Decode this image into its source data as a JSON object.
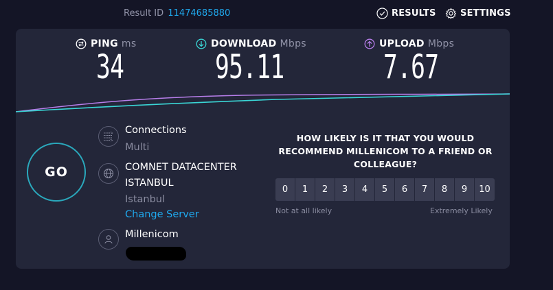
{
  "header": {
    "result_label": "Result ID",
    "result_id": "11474685880",
    "results_label": "RESULTS",
    "settings_label": "SETTINGS"
  },
  "metrics": {
    "ping": {
      "label": "PING",
      "unit": "ms",
      "value": "34",
      "icon": "ping-icon"
    },
    "download": {
      "label": "DOWNLOAD",
      "unit": "Mbps",
      "value": "95.11",
      "icon": "download-arrow-icon",
      "color": "#3ad6d6"
    },
    "upload": {
      "label": "UPLOAD",
      "unit": "Mbps",
      "value": "7.67",
      "icon": "upload-arrow-icon",
      "color": "#b77eea"
    }
  },
  "go_label": "GO",
  "connections": {
    "title": "Connections",
    "value": "Multi",
    "icon": "connections-icon"
  },
  "server": {
    "name_line1": "COMNET DATACENTER",
    "name_line2": "ISTANBUL",
    "location": "Istanbul",
    "change_label": "Change Server",
    "icon": "globe-icon"
  },
  "provider": {
    "name": "Millenicom",
    "icon": "user-icon"
  },
  "survey": {
    "question": "HOW LIKELY IS IT THAT YOU WOULD RECOMMEND MILLENICOM TO A FRIEND OR COLLEAGUE?",
    "scale": [
      "0",
      "1",
      "2",
      "3",
      "4",
      "5",
      "6",
      "7",
      "8",
      "9",
      "10"
    ],
    "low_label": "Not at all likely",
    "high_label": "Extremely Likely"
  },
  "colors": {
    "background": "#141526",
    "panel": "#232639",
    "accent_blue": "#1fa9ee",
    "download": "#3ad6d6",
    "upload": "#b77eea",
    "go_ring": "#2aa8bc"
  }
}
